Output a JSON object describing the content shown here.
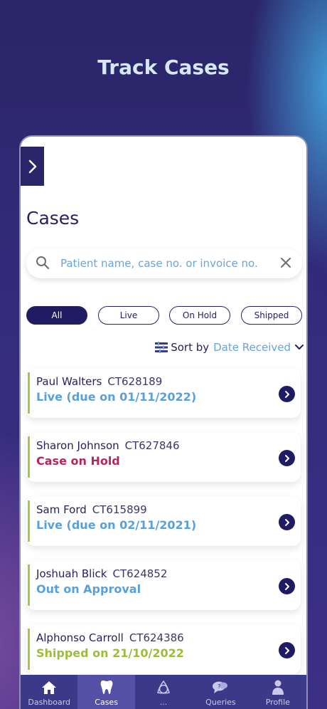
{
  "page": {
    "title": "Track Cases"
  },
  "panel": {
    "heading": "Cases"
  },
  "search": {
    "placeholder": "Patient name, case no. or invoice no."
  },
  "filters": [
    "All",
    "Live",
    "On Hold",
    "Shipped"
  ],
  "sort": {
    "label": "Sort by",
    "value": "Date Received"
  },
  "cases": [
    {
      "name": "Paul Walters",
      "case_no": "CT628189",
      "status": "Live (due on 01/11/2022)",
      "status_color": "#5aa0d8"
    },
    {
      "name": "Sharon Johnson",
      "case_no": "CT627846",
      "status": "Case on Hold",
      "status_color": "#b2285e"
    },
    {
      "name": "Sam Ford",
      "case_no": "CT615899",
      "status": "Live (due on 02/11/2021)",
      "status_color": "#5aa0d8"
    },
    {
      "name": "Joshuah Blick",
      "case_no": "CT624852",
      "status": "Out on Approval",
      "status_color": "#5aa0d8"
    },
    {
      "name": "Alphonso Carroll",
      "case_no": "CT624386",
      "status": "Shipped on 21/10/2022",
      "status_color": "#9bbd3a"
    }
  ],
  "nav": {
    "items": [
      {
        "label": "Dashboard",
        "icon": "home-icon"
      },
      {
        "label": "Cases",
        "icon": "tooth-icon"
      },
      {
        "label": "...",
        "icon": "knot-icon"
      },
      {
        "label": "Queries",
        "icon": "chat-bubbles-icon"
      },
      {
        "label": "Profile",
        "icon": "person-icon"
      }
    ]
  },
  "colors": {
    "accent": "#201c63",
    "link": "#6aa4d8",
    "nav_bg": "#3b3a88",
    "left_bar": "#a6c84a"
  }
}
